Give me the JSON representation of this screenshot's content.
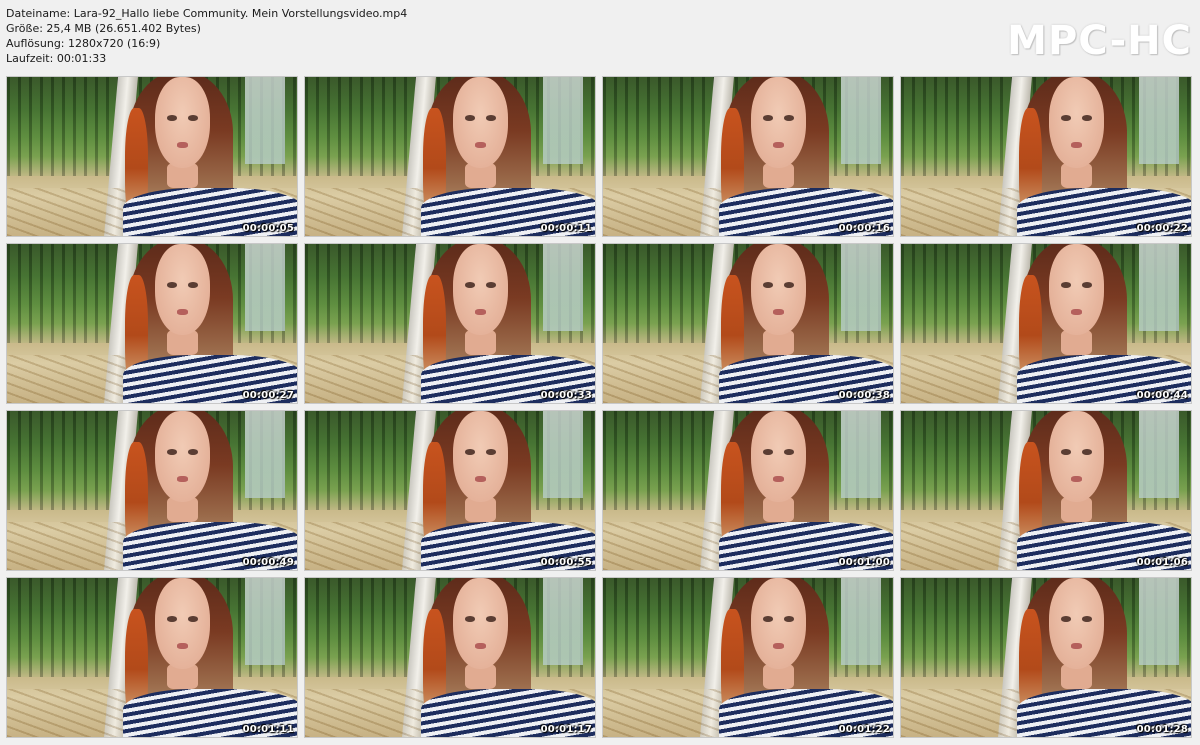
{
  "file_info": {
    "name_line": "Dateiname: Lara-92_Hallo liebe Community. Mein Vorstellungsvideo.mp4",
    "size_line": "Größe: 25,4 MB (26.651.402 Bytes)",
    "resolution_line": "Auflösung: 1280x720 (16:9)",
    "duration_line": "Laufzeit: 00:01:33"
  },
  "logo": "MPC-HC",
  "thumbnails": [
    {
      "time": "00:00:05"
    },
    {
      "time": "00:00:11"
    },
    {
      "time": "00:00:16"
    },
    {
      "time": "00:00:22"
    },
    {
      "time": "00:00:27"
    },
    {
      "time": "00:00:33"
    },
    {
      "time": "00:00:38"
    },
    {
      "time": "00:00:44"
    },
    {
      "time": "00:00:49"
    },
    {
      "time": "00:00:55"
    },
    {
      "time": "00:01:00"
    },
    {
      "time": "00:01:06"
    },
    {
      "time": "00:01:11"
    },
    {
      "time": "00:01:17"
    },
    {
      "time": "00:01:22"
    },
    {
      "time": "00:01:28"
    }
  ]
}
